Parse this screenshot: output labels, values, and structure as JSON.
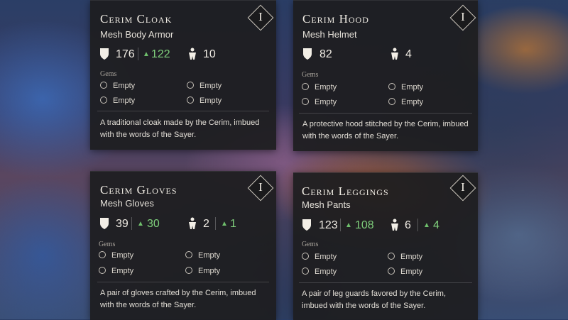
{
  "cards": [
    {
      "title": "Cerim Cloak",
      "subtitle": "Mesh Body Armor",
      "tier": "I",
      "armor": "176",
      "armor_bonus": "122",
      "weight": "10",
      "weight_bonus": "",
      "gems_label": "Gems",
      "gems": [
        "Empty",
        "Empty",
        "Empty",
        "Empty"
      ],
      "description": "A traditional cloak made by the Cerim, imbued with the words of the Sayer."
    },
    {
      "title": "Cerim Hood",
      "subtitle": "Mesh Helmet",
      "tier": "I",
      "armor": "82",
      "armor_bonus": "",
      "weight": "4",
      "weight_bonus": "",
      "gems_label": "Gems",
      "gems": [
        "Empty",
        "Empty",
        "Empty",
        "Empty"
      ],
      "description": "A protective hood stitched by the Cerim, imbued with the words of the Sayer."
    },
    {
      "title": "Cerim Gloves",
      "subtitle": "Mesh Gloves",
      "tier": "I",
      "armor": "39",
      "armor_bonus": "30",
      "weight": "2",
      "weight_bonus": "1",
      "gems_label": "Gems",
      "gems": [
        "Empty",
        "Empty",
        "Empty",
        "Empty"
      ],
      "description": "A pair of gloves crafted by the Cerim, imbued with the words of the Sayer."
    },
    {
      "title": "Cerim Leggings",
      "subtitle": "Mesh Pants",
      "tier": "I",
      "armor": "123",
      "armor_bonus": "108",
      "weight": "6",
      "weight_bonus": "4",
      "gems_label": "Gems",
      "gems": [
        "Empty",
        "Empty",
        "Empty",
        "Empty"
      ],
      "description": "A pair of leg guards favored by the Cerim, imbued with the words of the Sayer."
    }
  ],
  "colors": {
    "card_bg": "#1e1e20",
    "bonus_green": "#7fcf7c",
    "text": "#f0ece4"
  },
  "icons": {
    "armor": "shield-icon",
    "bonus": "upgrade-arrow-icon",
    "weight": "weight-figure-icon",
    "gem_slot": "empty-gem-slot-icon"
  }
}
